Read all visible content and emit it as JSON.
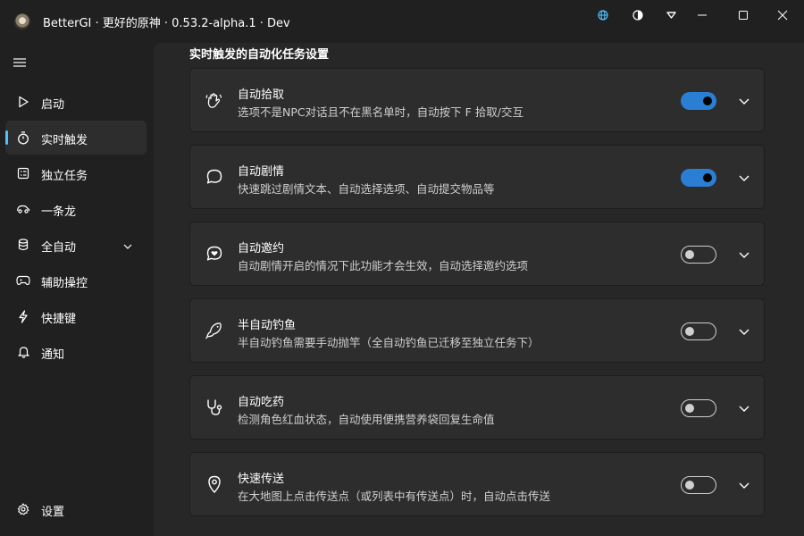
{
  "window": {
    "title": "BetterGI · 更好的原神 · 0.53.2-alpha.1 · Dev",
    "controls": [
      "globe-icon",
      "theme-toggle-icon",
      "dropdown-icon",
      "minimize-icon",
      "maximize-icon",
      "close-icon"
    ],
    "accent": "#4cc2ff"
  },
  "sidebar": {
    "menu_icon": "hamburger-menu-icon",
    "items": [
      {
        "label": "启动",
        "icon": "play-icon",
        "active": false
      },
      {
        "label": "实时触发",
        "icon": "timer-icon",
        "active": true
      },
      {
        "label": "独立任务",
        "icon": "task-list-icon",
        "active": false
      },
      {
        "label": "一条龙",
        "icon": "car-icon",
        "active": false
      },
      {
        "label": "全自动",
        "icon": "database-icon",
        "active": false,
        "expandable": true
      },
      {
        "label": "辅助操控",
        "icon": "gamepad-icon",
        "active": false
      },
      {
        "label": "快捷键",
        "icon": "flash-icon",
        "active": false
      },
      {
        "label": "通知",
        "icon": "bell-icon",
        "active": false
      }
    ],
    "settings": {
      "label": "设置",
      "icon": "gear-icon"
    }
  },
  "main": {
    "section_title": "实时触发的自动化任务设置",
    "cards": [
      {
        "title": "自动拾取",
        "desc": "选项不是NPC对话且不在黑名单时，自动按下 F 拾取/交互",
        "icon": "hand-wave-icon",
        "enabled": true
      },
      {
        "title": "自动剧情",
        "desc": "快速跳过剧情文本、自动选择选项、自动提交物品等",
        "icon": "chat-bubble-icon",
        "enabled": true
      },
      {
        "title": "自动邀约",
        "desc": "自动剧情开启的情况下此功能才会生效，自动选择邀约选项",
        "icon": "chat-heart-icon",
        "enabled": false
      },
      {
        "title": "半自动钓鱼",
        "desc": "半自动钓鱼需要手动抛竿（全自动钓鱼已迁移至独立任务下）",
        "icon": "fish-icon",
        "enabled": false
      },
      {
        "title": "自动吃药",
        "desc": "检测角色红血状态，自动使用便携营养袋回复生命值",
        "icon": "stethoscope-icon",
        "enabled": false
      },
      {
        "title": "快速传送",
        "desc": "在大地图上点击传送点（或列表中有传送点）时，自动点击传送",
        "icon": "location-pin-icon",
        "enabled": false
      }
    ]
  },
  "colors": {
    "toggle_on": "#2a7fd4",
    "card_bg": "#2d2d2d",
    "content_bg": "#272727",
    "window_bg": "#202020"
  }
}
